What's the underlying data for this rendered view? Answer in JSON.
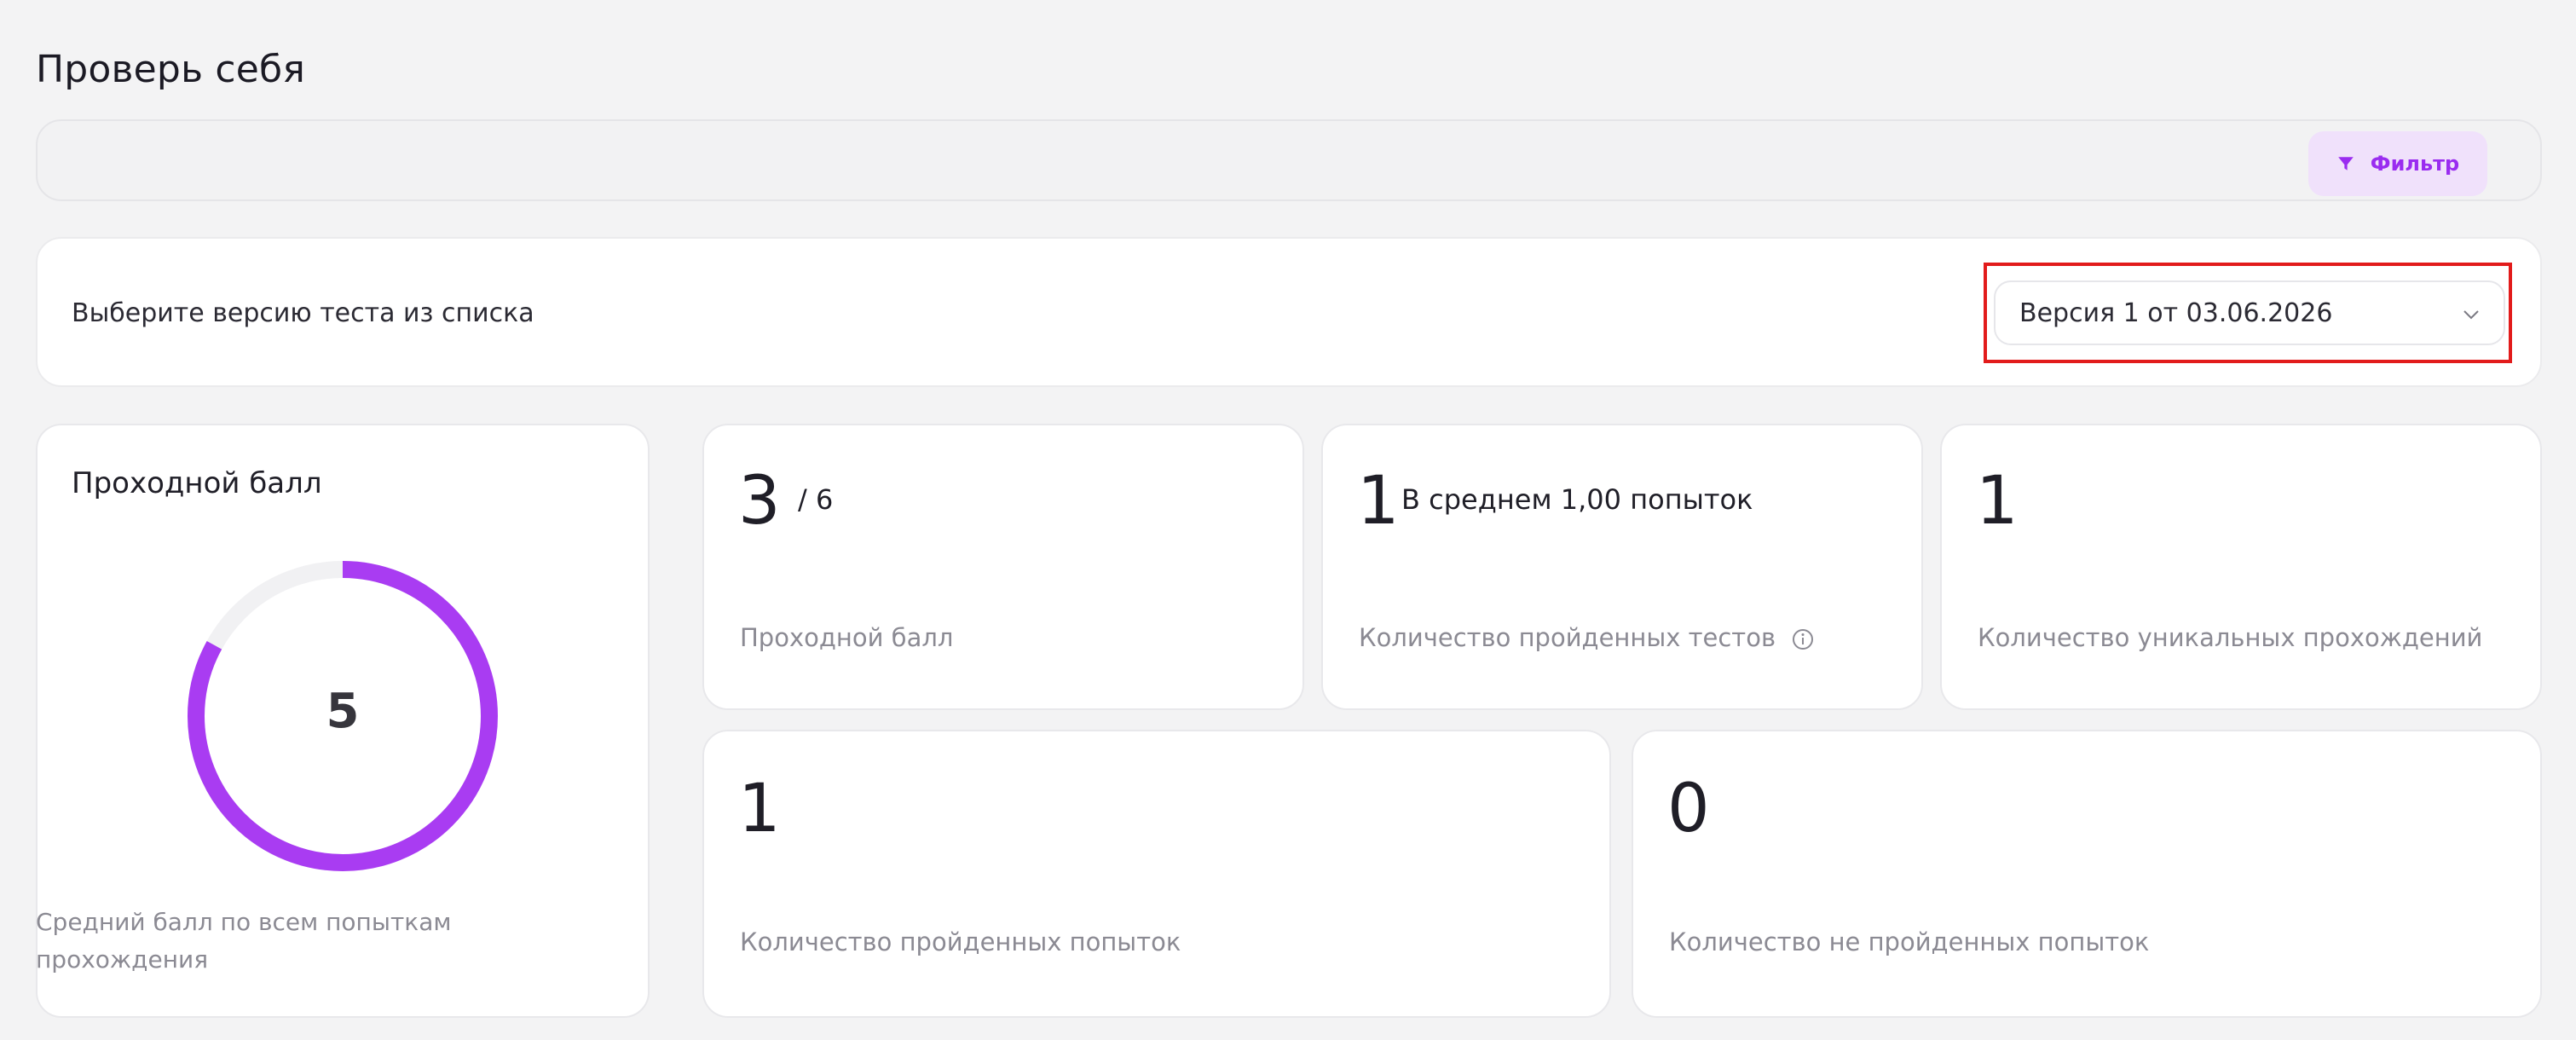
{
  "page": {
    "title": "Проверь себя"
  },
  "filter": {
    "button_label": "Фильтр",
    "icon": "filter-icon",
    "accent": "#9a2cf0"
  },
  "version": {
    "prompt": "Выберите версию теста из списка",
    "selected": "Версия 1 от 03.06.2026",
    "highlight_color": "#e21b1b"
  },
  "passing_score_card": {
    "title": "Проходной балл",
    "value": "5",
    "progress_fraction": 0.83,
    "ring_color": "#a93cf2",
    "caption": "Средний балл по всем попыткам прохождения"
  },
  "stats": {
    "passing": {
      "value": "3",
      "suffix": "/ 6",
      "label": "Проходной балл"
    },
    "tests_passed": {
      "value": "1",
      "suffix": "В среднем 1,00 попыток",
      "label": "Количество пройденных тестов",
      "icon": "info-icon"
    },
    "unique": {
      "value": "1",
      "label": "Количество уникальных прохождений"
    },
    "attempts_passed": {
      "value": "1",
      "label": "Количество пройденных попыток"
    },
    "attempts_failed": {
      "value": "0",
      "label": "Количество не пройденных попыток"
    }
  }
}
